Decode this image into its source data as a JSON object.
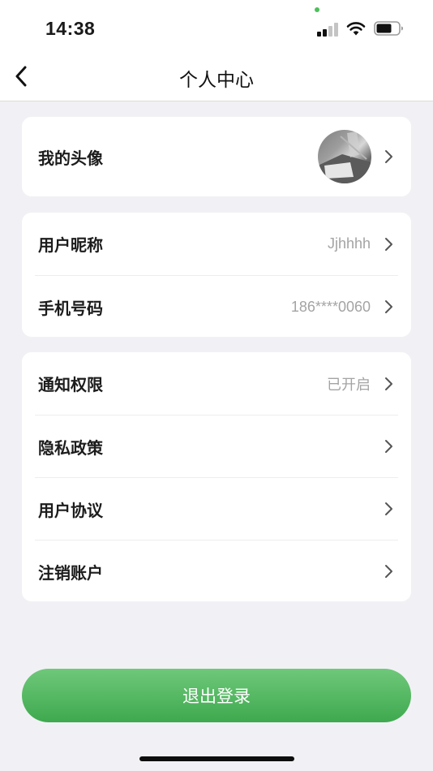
{
  "status_bar": {
    "time": "14:38"
  },
  "header": {
    "title": "个人中心",
    "back_icon": "chevron-left-icon"
  },
  "avatar_card": {
    "label": "我的头像"
  },
  "account_card": {
    "rows": [
      {
        "label": "用户昵称",
        "value": "Jjhhhh"
      },
      {
        "label": "手机号码",
        "value": "186****0060"
      }
    ]
  },
  "settings_card": {
    "rows": [
      {
        "label": "通知权限",
        "value": "已开启"
      },
      {
        "label": "隐私政策",
        "value": ""
      },
      {
        "label": "用户协议",
        "value": ""
      },
      {
        "label": "注销账户",
        "value": ""
      }
    ]
  },
  "logout": {
    "label": "退出登录"
  },
  "colors": {
    "accent_green": "#4cb35a",
    "background": "#f1f1f5",
    "muted_text": "#a4a4a4"
  }
}
